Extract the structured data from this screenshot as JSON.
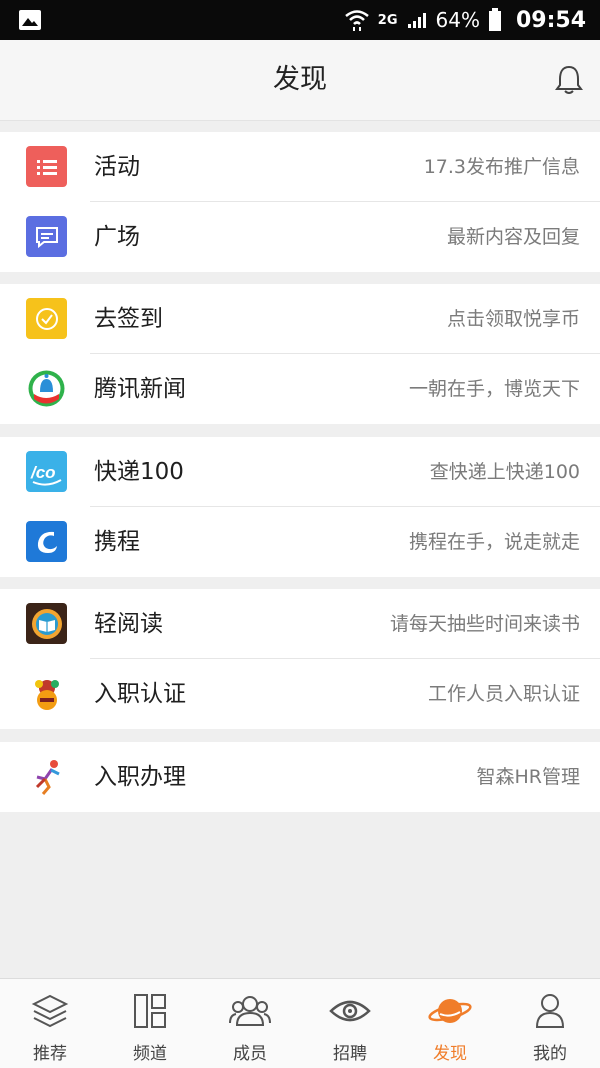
{
  "status_bar": {
    "network": "2G",
    "battery": "64%",
    "time": "09:54"
  },
  "header": {
    "title": "发现"
  },
  "groups": [
    {
      "items": [
        {
          "label": "活动",
          "desc": "17.3发布推广信息",
          "icon": "list-icon"
        },
        {
          "label": "广场",
          "desc": "最新内容及回复",
          "icon": "chat-icon"
        }
      ]
    },
    {
      "items": [
        {
          "label": "去签到",
          "desc": "点击领取悦享币",
          "icon": "clock-checkin-icon"
        },
        {
          "label": "腾讯新闻",
          "desc": "一朝在手，博览天下",
          "icon": "tencent-news-icon"
        }
      ]
    },
    {
      "items": [
        {
          "label": "快递100",
          "desc": "查快递上快递100",
          "icon": "kuaidi100-icon"
        },
        {
          "label": "携程",
          "desc": "携程在手，说走就走",
          "icon": "ctrip-dolphin-icon"
        }
      ]
    },
    {
      "items": [
        {
          "label": "轻阅读",
          "desc": "请每天抽些时间来读书",
          "icon": "reading-book-icon"
        },
        {
          "label": "入职认证",
          "desc": "工作人员入职认证",
          "icon": "badge-certify-icon"
        }
      ]
    },
    {
      "items": [
        {
          "label": "入职办理",
          "desc": "智森HR管理",
          "icon": "running-person-icon"
        }
      ]
    }
  ],
  "bottom_nav": [
    {
      "label": "推荐",
      "icon": "layers-icon"
    },
    {
      "label": "频道",
      "icon": "grid-icon"
    },
    {
      "label": "成员",
      "icon": "members-icon"
    },
    {
      "label": "招聘",
      "icon": "eye-icon"
    },
    {
      "label": "发现",
      "icon": "planet-icon",
      "active": true
    },
    {
      "label": "我的",
      "icon": "person-icon"
    }
  ],
  "colors": {
    "accent": "#f07d2a",
    "background": "#efefef"
  }
}
